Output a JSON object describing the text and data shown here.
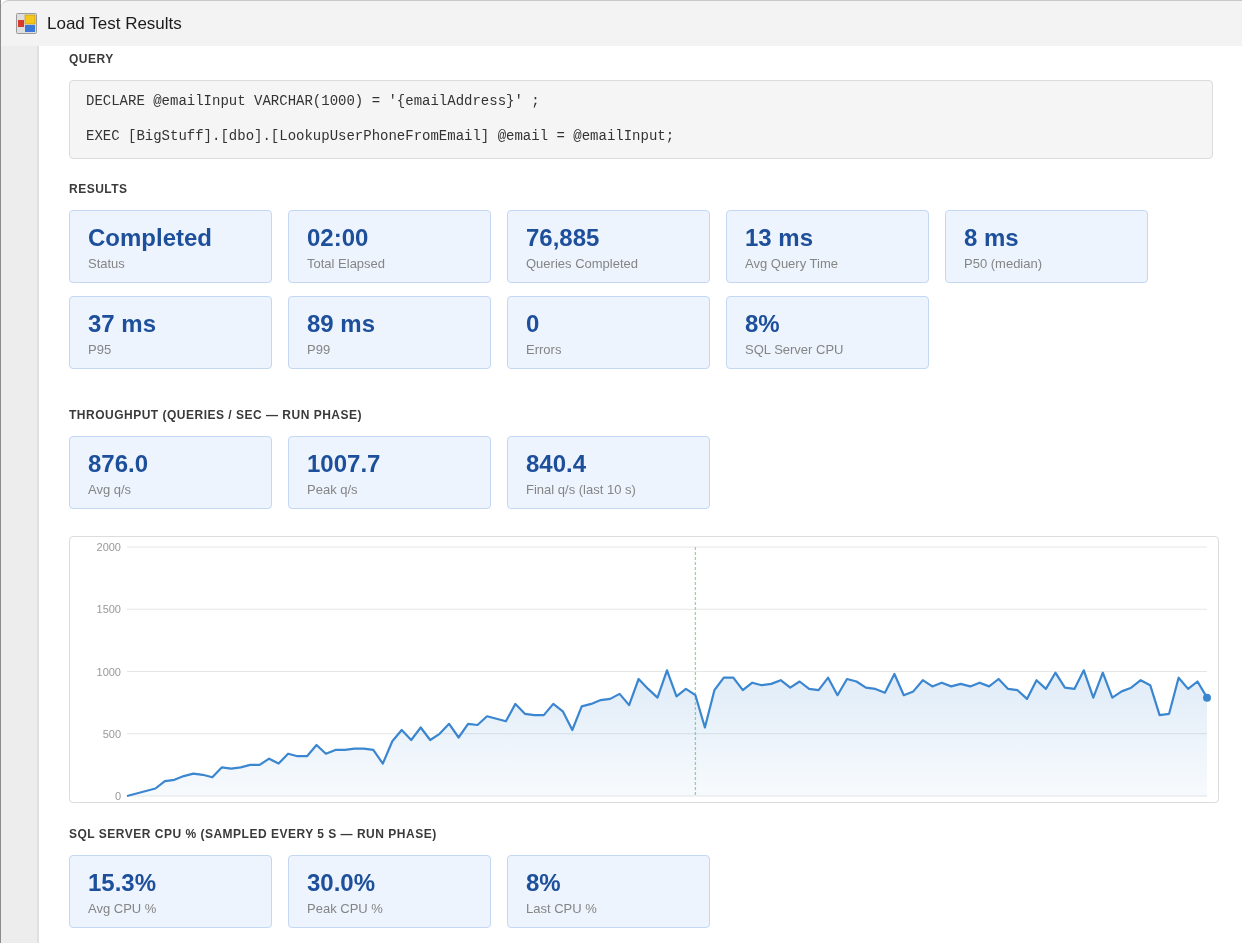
{
  "window": {
    "title": "Load Test Results"
  },
  "query": {
    "heading": "QUERY",
    "code_lines": [
      "DECLARE @emailInput VARCHAR(1000) = '{emailAddress}' ;",
      "EXEC [BigStuff].[dbo].[LookupUserPhoneFromEmail] @email = @emailInput;"
    ]
  },
  "results": {
    "heading": "RESULTS",
    "stats": [
      {
        "value": "Completed",
        "label": "Status"
      },
      {
        "value": "02:00",
        "label": "Total Elapsed"
      },
      {
        "value": "76,885",
        "label": "Queries Completed"
      },
      {
        "value": "13 ms",
        "label": "Avg Query Time"
      },
      {
        "value": "8 ms",
        "label": "P50 (median)"
      },
      {
        "value": "37 ms",
        "label": "P95"
      },
      {
        "value": "89 ms",
        "label": "P99"
      },
      {
        "value": "0",
        "label": "Errors"
      },
      {
        "value": "8%",
        "label": "SQL Server CPU"
      }
    ]
  },
  "throughput": {
    "heading": "THROUGHPUT (QUERIES / SEC — RUN PHASE)",
    "stats": [
      {
        "value": "876.0",
        "label": "Avg q/s"
      },
      {
        "value": "1007.7",
        "label": "Peak q/s"
      },
      {
        "value": "840.4",
        "label": "Final q/s (last 10 s)"
      }
    ],
    "chart_data": {
      "type": "area",
      "categories": [
        null,
        null,
        null,
        null,
        null,
        null,
        null,
        null,
        null,
        null,
        null,
        null,
        null,
        null,
        null,
        null,
        null,
        null,
        null,
        null,
        null,
        null,
        null,
        null,
        null,
        null,
        null,
        null,
        null,
        null,
        null,
        null,
        null,
        null,
        null,
        null,
        null,
        null,
        null,
        null,
        null,
        null,
        null,
        null,
        null,
        null,
        null,
        null,
        null,
        null,
        null,
        null,
        null,
        null,
        null,
        null,
        null,
        null,
        null,
        null,
        null,
        null,
        null,
        null,
        null,
        null,
        null,
        null,
        null,
        null,
        null,
        null,
        null,
        null,
        null,
        null,
        null,
        null,
        null,
        null,
        null,
        null,
        null,
        null,
        null,
        null,
        null,
        null,
        null,
        null,
        null,
        null,
        null,
        null,
        null,
        null,
        null,
        null,
        null,
        null,
        null,
        null,
        null,
        null,
        null,
        null,
        null,
        null,
        null,
        null,
        null,
        null,
        null,
        null,
        null
      ],
      "ylim": [
        0,
        2000
      ],
      "yticks": [
        0,
        500,
        1000,
        1500,
        2000
      ],
      "grid": true,
      "series": [
        {
          "color": "#3a86d0",
          "values": [
            0,
            20,
            40,
            60,
            120,
            130,
            160,
            180,
            170,
            150,
            230,
            220,
            230,
            250,
            250,
            300,
            260,
            340,
            320,
            320,
            410,
            340,
            370,
            370,
            380,
            380,
            370,
            260,
            440,
            530,
            450,
            550,
            450,
            500,
            580,
            470,
            580,
            570,
            640,
            620,
            600,
            740,
            660,
            650,
            650,
            740,
            680,
            530,
            720,
            740,
            770,
            780,
            820,
            730,
            940,
            860,
            790,
            1010,
            800,
            860,
            810,
            550,
            850,
            950,
            950,
            850,
            910,
            890,
            900,
            930,
            870,
            920,
            860,
            850,
            950,
            810,
            940,
            920,
            870,
            860,
            830,
            980,
            810,
            840,
            930,
            880,
            910,
            880,
            900,
            880,
            910,
            880,
            940,
            860,
            850,
            780,
            930,
            860,
            990,
            870,
            860,
            1010,
            790,
            990,
            790,
            840,
            870,
            930,
            890,
            650,
            660,
            950,
            860,
            920,
            790
          ]
        }
      ]
    }
  },
  "cpu": {
    "heading": "SQL SERVER CPU % (SAMPLED EVERY 5 S — RUN PHASE)",
    "stats": [
      {
        "value": "15.3%",
        "label": "Avg CPU %"
      },
      {
        "value": "30.0%",
        "label": "Peak CPU %"
      },
      {
        "value": "8%",
        "label": "Last CPU %"
      }
    ]
  }
}
